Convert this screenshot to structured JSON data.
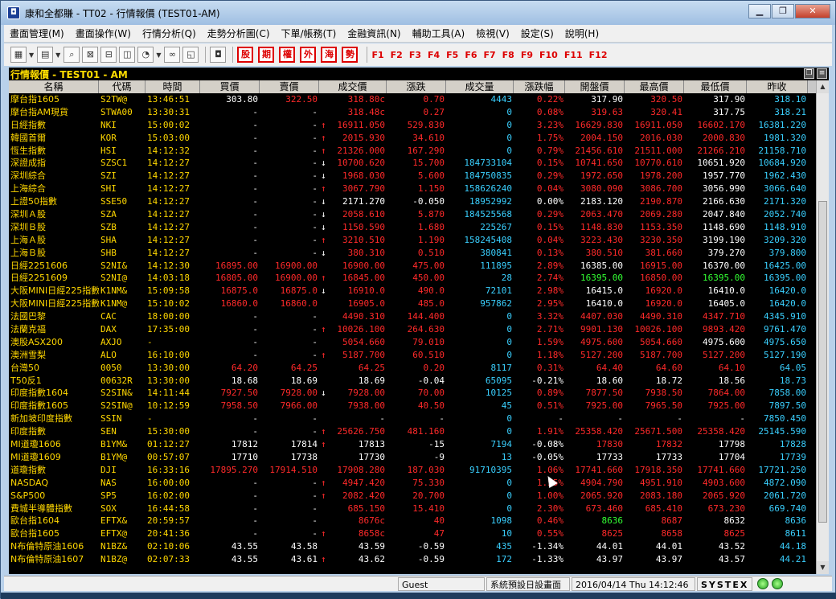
{
  "window": {
    "title": "康和全都賺 - TT02 - 行情報價 (TEST01-AM)",
    "icon": "app-logo-icon"
  },
  "menu": [
    "畫面管理(M)",
    "畫面操作(W)",
    "行情分析(Q)",
    "走勢分析圖(C)",
    "下單/帳務(T)",
    "金融資訊(N)",
    "輔助工具(A)",
    "檢視(V)",
    "設定(S)",
    "說明(H)"
  ],
  "toolbar": {
    "red_buttons": [
      "股",
      "期",
      "權",
      "外",
      "海",
      "勢"
    ],
    "fkeys": [
      "F1",
      "F2",
      "F3",
      "F4",
      "F5",
      "F6",
      "F7",
      "F8",
      "F9",
      "F10",
      "F11",
      "F12"
    ]
  },
  "panel": {
    "title": "行情報價 - TEST01 - AM"
  },
  "columns": [
    "名稱",
    "代碼",
    "時間",
    "買價",
    "賣價",
    "成交價",
    "漲跌",
    "成交量",
    "漲跌幅",
    "開盤價",
    "最高價",
    "最低價",
    "昨收"
  ],
  "rows": [
    {
      "name": "摩台指1605",
      "code": "S2TW@",
      "time": "13:46:51",
      "bid": "303.80",
      "ask": "322.50",
      "last": "318.80c",
      "chg": "0.70",
      "vol": "4443",
      "pct": "0.22%",
      "open": "317.90",
      "high": "320.50",
      "low": "317.90",
      "prev": "318.10",
      "cl": [
        "w",
        "r",
        "r",
        "r",
        "r",
        "w",
        "r",
        "w",
        "c"
      ],
      "arr": ""
    },
    {
      "name": "摩台指AM現貨",
      "code": "STWA00",
      "time": "13:30:31",
      "bid": "-",
      "ask": "-",
      "last": "318.48c",
      "chg": "0.27",
      "vol": "0",
      "pct": "0.08%",
      "open": "319.63",
      "high": "320.41",
      "low": "317.75",
      "prev": "318.21",
      "cl": [
        "w",
        "w",
        "r",
        "r",
        "r",
        "r",
        "r",
        "w",
        "c"
      ],
      "arr": ""
    },
    {
      "name": "日經指數",
      "code": "NKI",
      "time": "15:00:02",
      "bid": "-",
      "ask": "-",
      "last": "16911.050",
      "chg": "529.830",
      "vol": "0",
      "pct": "3.23%",
      "open": "16629.830",
      "high": "16911.050",
      "low": "16602.170",
      "prev": "16381.220",
      "cl": [
        "w",
        "w",
        "r",
        "r",
        "r",
        "r",
        "r",
        "r",
        "c"
      ],
      "arr": "up"
    },
    {
      "name": "韓國首爾",
      "code": "KOR",
      "time": "15:03:00",
      "bid": "-",
      "ask": "-",
      "last": "2015.930",
      "chg": "34.610",
      "vol": "0",
      "pct": "1.75%",
      "open": "2004.150",
      "high": "2016.030",
      "low": "2000.830",
      "prev": "1981.320",
      "cl": [
        "w",
        "w",
        "r",
        "r",
        "r",
        "r",
        "r",
        "r",
        "c"
      ],
      "arr": "up"
    },
    {
      "name": "恆生指數",
      "code": "HSI",
      "time": "14:12:32",
      "bid": "-",
      "ask": "-",
      "last": "21326.000",
      "chg": "167.290",
      "vol": "0",
      "pct": "0.79%",
      "open": "21456.610",
      "high": "21511.000",
      "low": "21266.210",
      "prev": "21158.710",
      "cl": [
        "w",
        "w",
        "r",
        "r",
        "r",
        "r",
        "r",
        "r",
        "c"
      ],
      "arr": "up"
    },
    {
      "name": "深證成指",
      "code": "SZSC1",
      "time": "14:12:27",
      "bid": "-",
      "ask": "-",
      "last": "10700.620",
      "chg": "15.700",
      "vol": "184733104",
      "pct": "0.15%",
      "open": "10741.650",
      "high": "10770.610",
      "low": "10651.920",
      "prev": "10684.920",
      "cl": [
        "w",
        "w",
        "r",
        "r",
        "r",
        "r",
        "r",
        "w",
        "c"
      ],
      "arr": "down"
    },
    {
      "name": "深圳綜合",
      "code": "SZI",
      "time": "14:12:27",
      "bid": "-",
      "ask": "-",
      "last": "1968.030",
      "chg": "5.600",
      "vol": "184750835",
      "pct": "0.29%",
      "open": "1972.650",
      "high": "1978.200",
      "low": "1957.770",
      "prev": "1962.430",
      "cl": [
        "w",
        "w",
        "r",
        "r",
        "r",
        "r",
        "r",
        "w",
        "c"
      ],
      "arr": "down"
    },
    {
      "name": "上海綜合",
      "code": "SHI",
      "time": "14:12:27",
      "bid": "-",
      "ask": "-",
      "last": "3067.790",
      "chg": "1.150",
      "vol": "158626240",
      "pct": "0.04%",
      "open": "3080.090",
      "high": "3086.700",
      "low": "3056.990",
      "prev": "3066.640",
      "cl": [
        "w",
        "w",
        "r",
        "r",
        "r",
        "r",
        "r",
        "w",
        "c"
      ],
      "arr": "up"
    },
    {
      "name": "上證50指數",
      "code": "SSE50",
      "time": "14:12:27",
      "bid": "-",
      "ask": "-",
      "last": "2171.270",
      "chg": "-0.050",
      "vol": "18952992",
      "pct": "0.00%",
      "open": "2183.120",
      "high": "2190.870",
      "low": "2166.630",
      "prev": "2171.320",
      "cl": [
        "w",
        "w",
        "w",
        "w",
        "w",
        "w",
        "r",
        "w",
        "c"
      ],
      "arr": "down"
    },
    {
      "name": "深圳Ａ股",
      "code": "SZA",
      "time": "14:12:27",
      "bid": "-",
      "ask": "-",
      "last": "2058.610",
      "chg": "5.870",
      "vol": "184525568",
      "pct": "0.29%",
      "open": "2063.470",
      "high": "2069.280",
      "low": "2047.840",
      "prev": "2052.740",
      "cl": [
        "w",
        "w",
        "r",
        "r",
        "r",
        "r",
        "r",
        "w",
        "c"
      ],
      "arr": "down"
    },
    {
      "name": "深圳Ｂ股",
      "code": "SZB",
      "time": "14:12:27",
      "bid": "-",
      "ask": "-",
      "last": "1150.590",
      "chg": "1.680",
      "vol": "225267",
      "pct": "0.15%",
      "open": "1148.830",
      "high": "1153.350",
      "low": "1148.690",
      "prev": "1148.910",
      "cl": [
        "w",
        "w",
        "r",
        "r",
        "r",
        "r",
        "r",
        "w",
        "c"
      ],
      "arr": "down"
    },
    {
      "name": "上海Ａ股",
      "code": "SHA",
      "time": "14:12:27",
      "bid": "-",
      "ask": "-",
      "last": "3210.510",
      "chg": "1.190",
      "vol": "158245408",
      "pct": "0.04%",
      "open": "3223.430",
      "high": "3230.350",
      "low": "3199.190",
      "prev": "3209.320",
      "cl": [
        "w",
        "w",
        "r",
        "r",
        "r",
        "r",
        "r",
        "w",
        "c"
      ],
      "arr": "up"
    },
    {
      "name": "上海Ｂ股",
      "code": "SHB",
      "time": "14:12:27",
      "bid": "-",
      "ask": "-",
      "last": "380.310",
      "chg": "0.510",
      "vol": "380841",
      "pct": "0.13%",
      "open": "380.510",
      "high": "381.660",
      "low": "379.270",
      "prev": "379.800",
      "cl": [
        "w",
        "w",
        "r",
        "r",
        "r",
        "r",
        "r",
        "w",
        "c"
      ],
      "arr": "down"
    },
    {
      "name": "日經2251606",
      "code": "S2NI&",
      "time": "14:12:30",
      "bid": "16895.00",
      "ask": "16900.00",
      "last": "16900.00",
      "chg": "475.00",
      "vol": "111895",
      "pct": "2.89%",
      "open": "16385.00",
      "high": "16915.00",
      "low": "16370.00",
      "prev": "16425.00",
      "cl": [
        "r",
        "r",
        "r",
        "r",
        "r",
        "w",
        "r",
        "w",
        "c"
      ],
      "arr": ""
    },
    {
      "name": "日經2251609",
      "code": "S2NI@",
      "time": "14:03:18",
      "bid": "16805.00",
      "ask": "16900.00",
      "last": "16845.00",
      "chg": "450.00",
      "vol": "28",
      "pct": "2.74%",
      "open": "16395.00",
      "high": "16850.00",
      "low": "16395.00",
      "prev": "16395.00",
      "cl": [
        "r",
        "r",
        "r",
        "r",
        "r",
        "g",
        "r",
        "g",
        "c"
      ],
      "arr": "up"
    },
    {
      "name": "大阪MINI日經225指數",
      "code": "K1NM&",
      "time": "15:09:58",
      "bid": "16875.0",
      "ask": "16875.0",
      "last": "16910.0",
      "chg": "490.0",
      "vol": "72101",
      "pct": "2.98%",
      "open": "16415.0",
      "high": "16920.0",
      "low": "16410.0",
      "prev": "16420.0",
      "cl": [
        "r",
        "r",
        "r",
        "r",
        "r",
        "w",
        "r",
        "w",
        "c"
      ],
      "arr": "down"
    },
    {
      "name": "大阪MINI日經225指數",
      "code": "K1NM@",
      "time": "15:10:02",
      "bid": "16860.0",
      "ask": "16860.0",
      "last": "16905.0",
      "chg": "485.0",
      "vol": "957862",
      "pct": "2.95%",
      "open": "16410.0",
      "high": "16920.0",
      "low": "16405.0",
      "prev": "16420.0",
      "cl": [
        "r",
        "r",
        "r",
        "r",
        "r",
        "w",
        "r",
        "w",
        "c"
      ],
      "arr": ""
    },
    {
      "name": "法國巴黎",
      "code": "CAC",
      "time": "18:00:00",
      "bid": "-",
      "ask": "-",
      "last": "4490.310",
      "chg": "144.400",
      "vol": "0",
      "pct": "3.32%",
      "open": "4407.030",
      "high": "4490.310",
      "low": "4347.710",
      "prev": "4345.910",
      "cl": [
        "w",
        "w",
        "r",
        "r",
        "r",
        "r",
        "r",
        "r",
        "c"
      ],
      "arr": ""
    },
    {
      "name": "法蘭克福",
      "code": "DAX",
      "time": "17:35:00",
      "bid": "-",
      "ask": "-",
      "last": "10026.100",
      "chg": "264.630",
      "vol": "0",
      "pct": "2.71%",
      "open": "9901.130",
      "high": "10026.100",
      "low": "9893.420",
      "prev": "9761.470",
      "cl": [
        "w",
        "w",
        "r",
        "r",
        "r",
        "r",
        "r",
        "r",
        "c"
      ],
      "arr": "up"
    },
    {
      "name": "澳股ASX200",
      "code": "AXJO",
      "time": "-",
      "bid": "-",
      "ask": "-",
      "last": "5054.660",
      "chg": "79.010",
      "vol": "0",
      "pct": "1.59%",
      "open": "4975.600",
      "high": "5054.660",
      "low": "4975.600",
      "prev": "4975.650",
      "cl": [
        "w",
        "w",
        "r",
        "r",
        "r",
        "r",
        "r",
        "w",
        "c"
      ],
      "arr": ""
    },
    {
      "name": "澳洲雪梨",
      "code": "ALO",
      "time": "16:10:00",
      "bid": "-",
      "ask": "-",
      "last": "5187.700",
      "chg": "60.510",
      "vol": "0",
      "pct": "1.18%",
      "open": "5127.200",
      "high": "5187.700",
      "low": "5127.200",
      "prev": "5127.190",
      "cl": [
        "w",
        "w",
        "r",
        "r",
        "r",
        "r",
        "r",
        "r",
        "c"
      ],
      "arr": "up"
    },
    {
      "name": "台灣50",
      "code": "0050",
      "time": "13:30:00",
      "bid": "64.20",
      "ask": "64.25",
      "last": "64.25",
      "chg": "0.20",
      "vol": "8117",
      "pct": "0.31%",
      "open": "64.40",
      "high": "64.60",
      "low": "64.10",
      "prev": "64.05",
      "cl": [
        "r",
        "r",
        "r",
        "r",
        "r",
        "r",
        "r",
        "r",
        "c"
      ],
      "arr": ""
    },
    {
      "name": "T50反1",
      "code": "00632R",
      "time": "13:30:00",
      "bid": "18.68",
      "ask": "18.69",
      "last": "18.69",
      "chg": "-0.04",
      "vol": "65095",
      "pct": "-0.21%",
      "open": "18.60",
      "high": "18.72",
      "low": "18.56",
      "prev": "18.73",
      "cl": [
        "w",
        "w",
        "w",
        "w",
        "w",
        "w",
        "w",
        "w",
        "c"
      ],
      "arr": ""
    },
    {
      "name": "印度指數1604",
      "code": "S2SIN&",
      "time": "14:11:44",
      "bid": "7927.50",
      "ask": "7928.00",
      "last": "7928.00",
      "chg": "70.00",
      "vol": "10125",
      "pct": "0.89%",
      "open": "7877.50",
      "high": "7938.50",
      "low": "7864.00",
      "prev": "7858.00",
      "cl": [
        "r",
        "r",
        "r",
        "r",
        "r",
        "r",
        "r",
        "r",
        "c"
      ],
      "arr": "down"
    },
    {
      "name": "印度指數1605",
      "code": "S2SIN@",
      "time": "10:12:59",
      "bid": "7958.50",
      "ask": "7966.00",
      "last": "7938.00",
      "chg": "40.50",
      "vol": "45",
      "pct": "0.51%",
      "open": "7925.00",
      "high": "7965.50",
      "low": "7925.00",
      "prev": "7897.50",
      "cl": [
        "r",
        "r",
        "r",
        "r",
        "r",
        "r",
        "r",
        "r",
        "c"
      ],
      "arr": ""
    },
    {
      "name": "新加坡印度指數",
      "code": "SSIN",
      "time": "-",
      "bid": "-",
      "ask": "-",
      "last": "-",
      "chg": "-",
      "vol": "0",
      "pct": "-",
      "open": "-",
      "high": "-",
      "low": "-",
      "prev": "7850.450",
      "cl": [
        "w",
        "w",
        "w",
        "w",
        "w",
        "w",
        "w",
        "w",
        "c"
      ],
      "arr": ""
    },
    {
      "name": "印度指數",
      "code": "SEN",
      "time": "15:30:00",
      "bid": "-",
      "ask": "-",
      "last": "25626.750",
      "chg": "481.160",
      "vol": "0",
      "pct": "1.91%",
      "open": "25358.420",
      "high": "25671.500",
      "low": "25358.420",
      "prev": "25145.590",
      "cl": [
        "w",
        "w",
        "r",
        "r",
        "r",
        "r",
        "r",
        "r",
        "c"
      ],
      "arr": "up"
    },
    {
      "name": "MI道瓊1606",
      "code": "B1YM&",
      "time": "01:12:27",
      "bid": "17812",
      "ask": "17814",
      "last": "17813",
      "chg": "-15",
      "vol": "7194",
      "pct": "-0.08%",
      "open": "17830",
      "high": "17832",
      "low": "17798",
      "prev": "17828",
      "cl": [
        "w",
        "w",
        "w",
        "w",
        "w",
        "r",
        "r",
        "w",
        "c"
      ],
      "arr": "up"
    },
    {
      "name": "MI道瓊1609",
      "code": "B1YM@",
      "time": "00:57:07",
      "bid": "17710",
      "ask": "17738",
      "last": "17730",
      "chg": "-9",
      "vol": "13",
      "pct": "-0.05%",
      "open": "17733",
      "high": "17733",
      "low": "17704",
      "prev": "17739",
      "cl": [
        "w",
        "w",
        "w",
        "w",
        "w",
        "w",
        "w",
        "w",
        "c"
      ],
      "arr": ""
    },
    {
      "name": "道瓊指數",
      "code": "DJI",
      "time": "16:33:16",
      "bid": "17895.270",
      "ask": "17914.510",
      "last": "17908.280",
      "chg": "187.030",
      "vol": "91710395",
      "pct": "1.06%",
      "open": "17741.660",
      "high": "17918.350",
      "low": "17741.660",
      "prev": "17721.250",
      "cl": [
        "r",
        "r",
        "r",
        "r",
        "r",
        "r",
        "r",
        "r",
        "c"
      ],
      "arr": ""
    },
    {
      "name": "NASDAQ",
      "code": "NAS",
      "time": "16:00:00",
      "bid": "-",
      "ask": "-",
      "last": "4947.420",
      "chg": "75.330",
      "vol": "0",
      "pct": "1.55%",
      "open": "4904.790",
      "high": "4951.910",
      "low": "4903.600",
      "prev": "4872.090",
      "cl": [
        "w",
        "w",
        "r",
        "r",
        "r",
        "r",
        "r",
        "r",
        "c"
      ],
      "arr": "up"
    },
    {
      "name": "S&P500",
      "code": "SP5",
      "time": "16:02:00",
      "bid": "-",
      "ask": "-",
      "last": "2082.420",
      "chg": "20.700",
      "vol": "0",
      "pct": "1.00%",
      "open": "2065.920",
      "high": "2083.180",
      "low": "2065.920",
      "prev": "2061.720",
      "cl": [
        "w",
        "w",
        "r",
        "r",
        "r",
        "r",
        "r",
        "r",
        "c"
      ],
      "arr": "up"
    },
    {
      "name": "費城半導體指數",
      "code": "SOX",
      "time": "16:44:58",
      "bid": "-",
      "ask": "-",
      "last": "685.150",
      "chg": "15.410",
      "vol": "0",
      "pct": "2.30%",
      "open": "673.460",
      "high": "685.410",
      "low": "673.230",
      "prev": "669.740",
      "cl": [
        "w",
        "w",
        "r",
        "r",
        "r",
        "r",
        "r",
        "r",
        "c"
      ],
      "arr": ""
    },
    {
      "name": "歐台指1604",
      "code": "EFTX&",
      "time": "20:59:57",
      "bid": "-",
      "ask": "-",
      "last": "8676c",
      "chg": "40",
      "vol": "1098",
      "pct": "0.46%",
      "open": "8636",
      "high": "8687",
      "low": "8632",
      "prev": "8636",
      "cl": [
        "w",
        "w",
        "r",
        "r",
        "r",
        "g",
        "r",
        "w",
        "c"
      ],
      "arr": ""
    },
    {
      "name": "歐台指1605",
      "code": "EFTX@",
      "time": "20:41:36",
      "bid": "-",
      "ask": "-",
      "last": "8658c",
      "chg": "47",
      "vol": "10",
      "pct": "0.55%",
      "open": "8625",
      "high": "8658",
      "low": "8625",
      "prev": "8611",
      "cl": [
        "w",
        "w",
        "r",
        "r",
        "r",
        "r",
        "r",
        "r",
        "c"
      ],
      "arr": "up"
    },
    {
      "name": "N布倫特原油1606",
      "code": "N1BZ&",
      "time": "02:10:06",
      "bid": "43.55",
      "ask": "43.58",
      "last": "43.59",
      "chg": "-0.59",
      "vol": "435",
      "pct": "-1.34%",
      "open": "44.01",
      "high": "44.01",
      "low": "43.52",
      "prev": "44.18",
      "cl": [
        "w",
        "w",
        "w",
        "w",
        "w",
        "w",
        "w",
        "w",
        "c"
      ],
      "arr": ""
    },
    {
      "name": "N布倫特原油1607",
      "code": "N1BZ@",
      "time": "02:07:33",
      "bid": "43.55",
      "ask": "43.61",
      "last": "43.62",
      "chg": "-0.59",
      "vol": "172",
      "pct": "-1.33%",
      "open": "43.97",
      "high": "43.97",
      "low": "43.57",
      "prev": "44.21",
      "cl": [
        "w",
        "w",
        "w",
        "w",
        "w",
        "w",
        "w",
        "w",
        "c"
      ],
      "arr": "up"
    }
  ],
  "status": {
    "user": "Guest",
    "layout": "系統預設日設畫面",
    "datetime": "2016/04/14 Thu 14:12:46",
    "brand": "SYSTEX"
  },
  "colors": {
    "up": "#ff2a2a",
    "white": "#ffffff",
    "green": "#33ff33",
    "volume": "#3ad0ff",
    "label": "#ffd700",
    "prev": "#3ad0ff"
  }
}
